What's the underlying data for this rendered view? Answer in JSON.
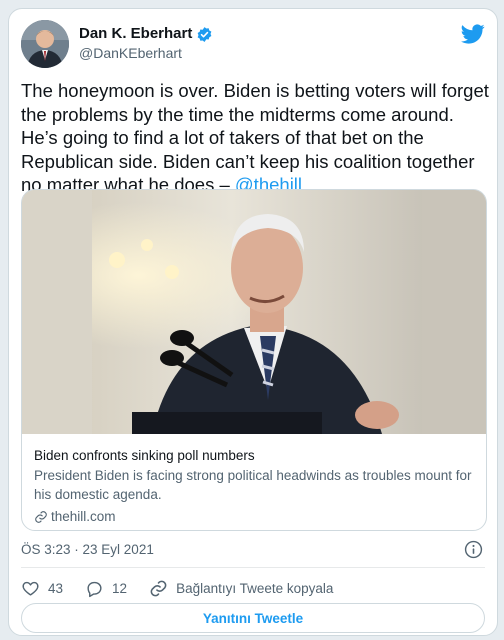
{
  "author": {
    "display_name": "Dan K. Eberhart",
    "handle": "@DanKEberhart",
    "verified": true
  },
  "tweet": {
    "text": "The honeymoon is over. Biden is betting voters will forget the problems by the time the midterms come around. He’s going to find a lot of takers of that bet on the Republican side. Biden can’t keep his coalition together no matter what he does – ",
    "mention": "@thehill"
  },
  "link_card": {
    "title": "Biden confronts sinking poll numbers",
    "description": "President Biden is facing strong political headwinds as troubles mount for his domestic agenda.",
    "domain": "thehill.com"
  },
  "timestamp": "ÖS 3:23 · 23 Eyl 2021",
  "actions": {
    "likes": "43",
    "replies": "12",
    "copy_link_label": "Bağlantıyı Tweete kopyala"
  },
  "reply_button_label": "Yanıtını Tweetle",
  "icons": [
    "verified-badge-icon",
    "twitter-bird-icon",
    "link-icon",
    "info-icon",
    "heart-icon",
    "reply-icon",
    "copy-link-icon"
  ],
  "colors": {
    "accent": "#1d9bf0",
    "text": "#0f1419",
    "muted": "#536471",
    "border": "#cfd9de"
  }
}
